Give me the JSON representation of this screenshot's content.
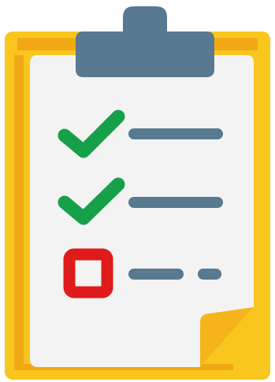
{
  "icon": {
    "name": "clipboard-checklist-icon",
    "colors": {
      "board": "#F9C61E",
      "board_shadow": "#F2A814",
      "paper": "#F3F3F3",
      "paper_fold": "#F5B51A",
      "clip": "#587A90",
      "check": "#17A04A",
      "unchecked_box": "#E01B1B",
      "line": "#587A90"
    }
  },
  "checklist": {
    "items": [
      {
        "state": "checked",
        "marker_icon": "checkmark-icon",
        "line_icon": "text-line"
      },
      {
        "state": "checked",
        "marker_icon": "checkmark-icon",
        "line_icon": "text-line"
      },
      {
        "state": "unchecked",
        "marker_icon": "empty-checkbox-icon",
        "line_icon": "text-line-dashed"
      }
    ]
  }
}
